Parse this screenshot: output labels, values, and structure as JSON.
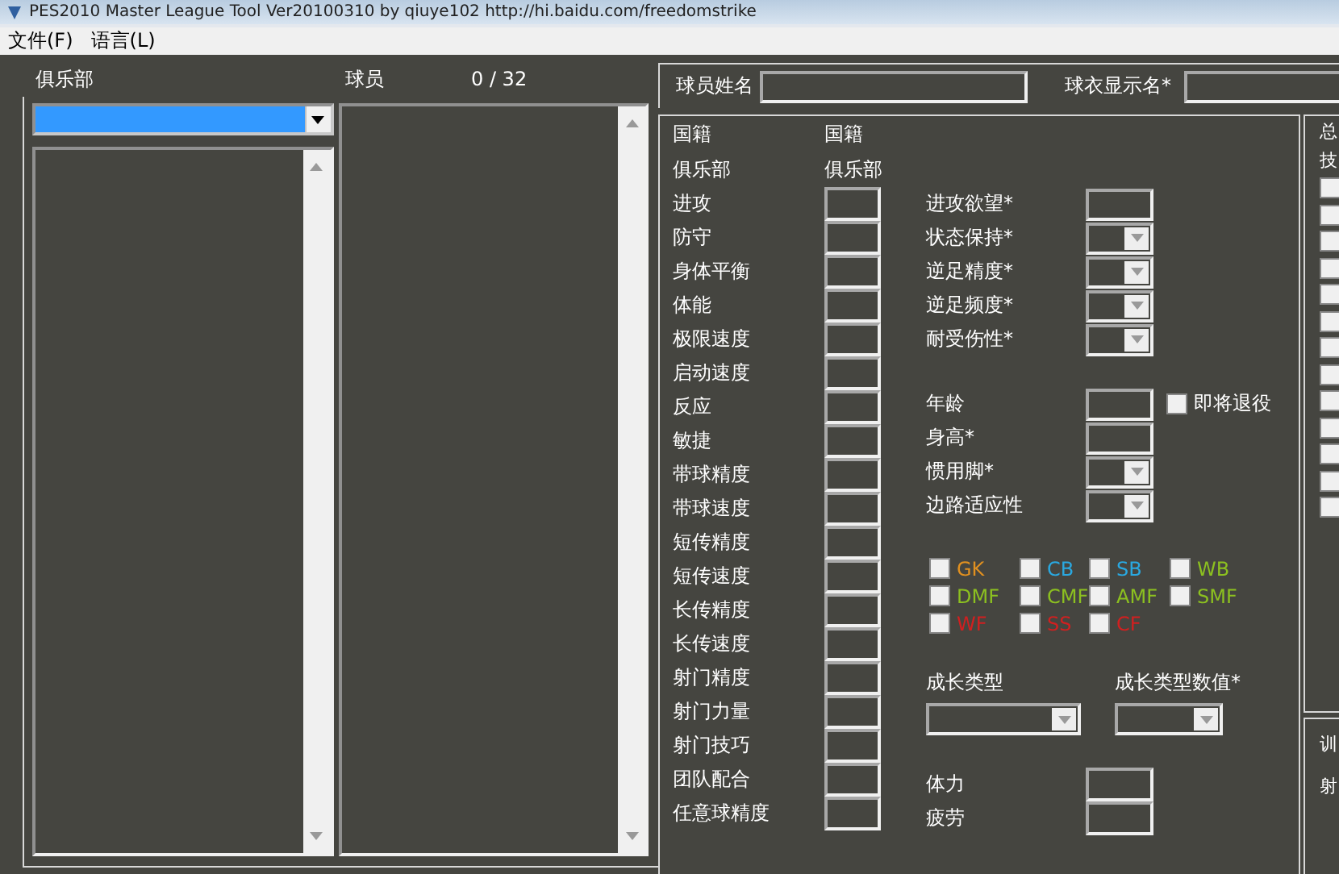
{
  "window": {
    "title": "PES2010 Master League Tool Ver20100310   by qiuye102      http://hi.baidu.com/freedomstrike"
  },
  "menu": [
    {
      "label": "文件(F)"
    },
    {
      "label": "语言(L)"
    }
  ],
  "header": {
    "club_label": "俱乐部",
    "player_label": "球员",
    "player_count": "0 / 32"
  },
  "club_combo": {
    "highlighted": true
  },
  "name_row": {
    "name_label": "球员姓名",
    "shirt_label": "球衣显示名*"
  },
  "info": [
    {
      "label": "国籍",
      "value": "国籍"
    },
    {
      "label": "俱乐部",
      "value": "俱乐部"
    }
  ],
  "attributes": [
    {
      "label": "进攻"
    },
    {
      "label": "防守"
    },
    {
      "label": "身体平衡"
    },
    {
      "label": "体能"
    },
    {
      "label": "极限速度"
    },
    {
      "label": "启动速度"
    },
    {
      "label": "反应"
    },
    {
      "label": "敏捷"
    },
    {
      "label": "带球精度"
    },
    {
      "label": "带球速度"
    },
    {
      "label": "短传精度"
    },
    {
      "label": "短传速度"
    },
    {
      "label": "长传精度"
    },
    {
      "label": "长传速度"
    },
    {
      "label": "射门精度"
    },
    {
      "label": "射门力量"
    },
    {
      "label": "射门技巧"
    },
    {
      "label": "团队配合"
    },
    {
      "label": "任意球精度"
    }
  ],
  "settings": [
    {
      "label": "进攻欲望*",
      "kind": "text"
    },
    {
      "label": "状态保持*",
      "kind": "combo"
    },
    {
      "label": "逆足精度*",
      "kind": "combo"
    },
    {
      "label": "逆足频度*",
      "kind": "combo"
    },
    {
      "label": "耐受伤性*",
      "kind": "combo"
    }
  ],
  "profile": [
    {
      "label": "年龄",
      "kind": "text"
    },
    {
      "label": "身高*",
      "kind": "text"
    },
    {
      "label": "惯用脚*",
      "kind": "combo"
    },
    {
      "label": "边路适应性",
      "kind": "combo"
    }
  ],
  "retire": {
    "label": "即将退役",
    "checked": false
  },
  "positions": [
    {
      "label": "GK",
      "color": "#e09020",
      "checked": false
    },
    {
      "label": "CB",
      "color": "#2aa8e0",
      "checked": false
    },
    {
      "label": "SB",
      "color": "#2aa8e0",
      "checked": false
    },
    {
      "label": "WB",
      "color": "#8cc020",
      "checked": false
    },
    {
      "label": "DMF",
      "color": "#8cc020",
      "checked": false
    },
    {
      "label": "CMF",
      "color": "#8cc020",
      "checked": false
    },
    {
      "label": "AMF",
      "color": "#8cc020",
      "checked": false
    },
    {
      "label": "SMF",
      "color": "#8cc020",
      "checked": false
    },
    {
      "label": "WF",
      "color": "#d02020",
      "checked": false
    },
    {
      "label": "SS",
      "color": "#d02020",
      "checked": false
    },
    {
      "label": "CF",
      "color": "#d02020",
      "checked": false
    }
  ],
  "growth": [
    {
      "label": "成长类型"
    },
    {
      "label": "成长类型数值*"
    }
  ],
  "condition": [
    {
      "label": "体力"
    },
    {
      "label": "疲劳"
    }
  ],
  "side_panel": {
    "texts": [
      "总",
      "技"
    ],
    "checkboxes": [
      {
        "checked": false
      },
      {
        "checked": false
      },
      {
        "checked": false
      },
      {
        "checked": false
      },
      {
        "checked": false
      },
      {
        "checked": false
      },
      {
        "checked": false
      },
      {
        "checked": false
      },
      {
        "checked": false
      },
      {
        "checked": false
      },
      {
        "checked": false
      },
      {
        "checked": false
      },
      {
        "checked": false
      }
    ],
    "lower_texts": [
      "训",
      "射"
    ]
  }
}
